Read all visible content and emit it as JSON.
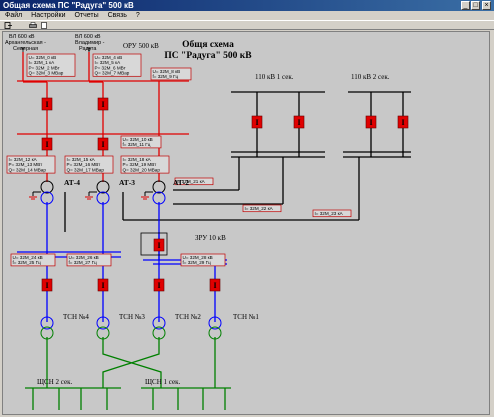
{
  "window": {
    "title": "Общая схема ПС \"Радуга\" 500 кВ",
    "buttons": [
      "_",
      "□",
      "×"
    ]
  },
  "menu": [
    "Файл",
    "Настройки",
    "Отчеты",
    "Связь",
    "?"
  ],
  "toolbar": {
    "icons": [
      "exit-icon",
      "print-icon",
      "document-icon"
    ]
  },
  "scheme": {
    "title_line1": "Общя схема",
    "title_line2": "ПС \"Радуга\" 500 кВ",
    "oru_label": "ОРУ 500 кВ",
    "line_left_label": "ВЛ 600 кВ",
    "line_left_name_1": "Архангельская -",
    "line_left_name_2": "Северная",
    "line_right_label": "ВЛ 600 кВ",
    "line_right_name_1": "Владимир -",
    "line_right_name_2": "Радуга",
    "sec1_label": "110 кВ 1 сек.",
    "sec2_label": "110 кВ 2 сек.",
    "zru_label": "ЗРУ 10 кВ",
    "at4": "АТ-4",
    "at3": "АТ-3",
    "at2": "АТ-2",
    "tsn4": "ТСН №4",
    "tsn3": "ТСН №3",
    "tsn2": "ТСН №2",
    "tsn1": "ТСН №1",
    "shsn2": "ЩСН 2 сек.",
    "shsn1": "ЩСН 1 сек.",
    "breaker_symbol": "I",
    "meters": {
      "line_left": [
        "U= 32М_0  кВ",
        "I= 32М_1  кА",
        "P= 32М_2  МВт",
        "Q= 32М_3  МВар"
      ],
      "line_right": [
        "U= 32М_4  кВ",
        "I= 32М_5  кА",
        "P= 32М_6  МВт",
        "Q= 32М_7  МВар"
      ],
      "bus_top": [
        "U= 32М_8  кВ",
        "f= 32М_9  Гц"
      ],
      "bus_mid": [
        "U= 32М_10 кВ",
        "f= 32М_11 Гц"
      ],
      "at4": [
        "I= 32М_12 кА",
        "P= 32М_13 МВт",
        "Q= 32М_14 МВар"
      ],
      "at3": [
        "I= 32М_15 кА",
        "P= 32М_16 МВт",
        "Q= 32М_17 МВар"
      ],
      "at2": [
        "I= 32М_18 кА",
        "P= 32М_19 МВт",
        "Q= 32М_20 МВар"
      ],
      "at2_110": "I= 32М_21 кА",
      "at3_110": "I= 32М_22 кА",
      "at4_110": "I= 32М_23 кА",
      "bus10_left": [
        "U= 32М_24 кВ",
        "f= 32М_25 Гц"
      ],
      "bus10_mid": [
        "U= 32М_26 кВ",
        "f= 32М_27 Гц"
      ],
      "bus10_right": [
        "U= 32М_28 кВ",
        "f= 32М_29 Гц"
      ]
    }
  },
  "colors": {
    "bus_500": "#e00000",
    "bus_110": "#000000",
    "bus_10": "#0000ff",
    "bus_04": "#008000",
    "breaker": "#e00000",
    "meter_border": "#c00000",
    "canvas": "#c8c8c8"
  }
}
